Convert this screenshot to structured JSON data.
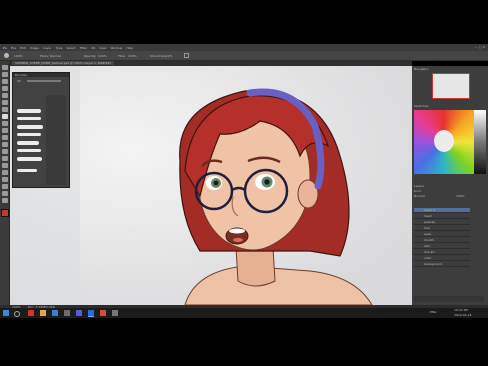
{
  "menu": {
    "items": [
      "File",
      "Edit",
      "Image",
      "Layer",
      "Type",
      "Select",
      "Filter",
      "3D",
      "View",
      "Window",
      "Help"
    ]
  },
  "options": {
    "zoom_value": "100%",
    "opacity_label": "Opacity:",
    "opacity_value": "100%",
    "flow_label": "Flow:",
    "flow_value": "100%",
    "smoothing_label": "Smoothing:",
    "smoothing_value": "10%"
  },
  "document": {
    "tab_title": "SUMMER_SCENE_HOME_backup.psd @ 100% (Layer 1, RGB/8#)"
  },
  "brushes_panel": {
    "title": "Brushes",
    "size_value": "20"
  },
  "right": {
    "navigator_title": "Navigator",
    "swatches_title": "Swatches",
    "layers_title": "Layers",
    "kind_label": "Kind",
    "blend_mode": "Normal",
    "opacity_value": "100%",
    "layers": [
      "Layer 1",
      "head",
      "glasses",
      "hair",
      "eyes",
      "mouth",
      "skin",
      "line art",
      "color",
      "background"
    ]
  },
  "status": {
    "zoom": "100%",
    "doc_size": "Doc: 5.93M/2.90G"
  },
  "taskbar": {
    "time": "19:03 PM",
    "date": "2019-04-18",
    "language": "ENG"
  },
  "colors": {
    "foreground": "#c0392b",
    "background": "#ffffff",
    "hair": "#b5302a",
    "headband": "#6a5fc4"
  }
}
